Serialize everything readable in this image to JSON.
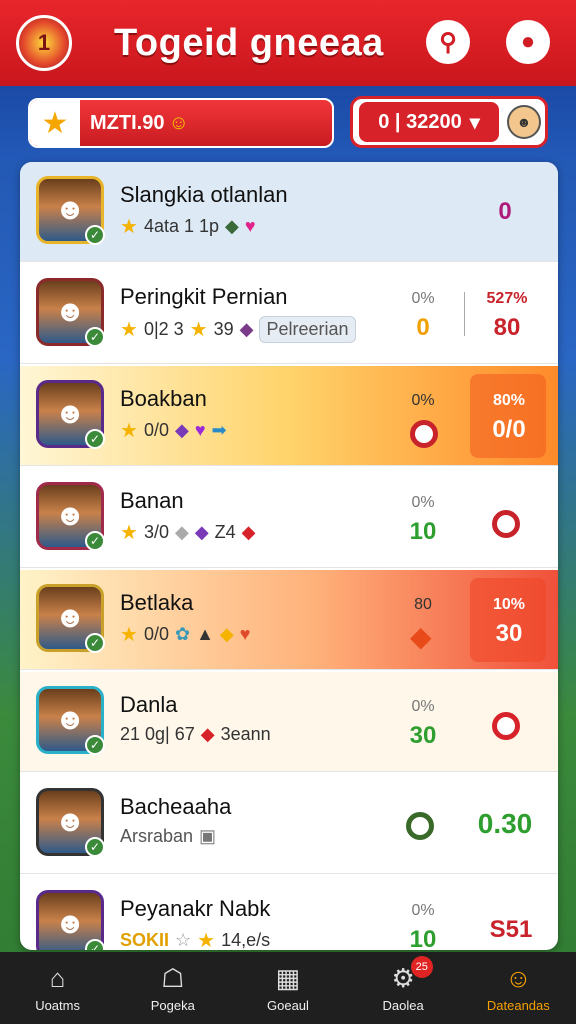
{
  "header": {
    "title": "Togeid gneeaa",
    "logo_glyph": "1",
    "search_icon": "search-icon",
    "profile_icon": "profile-icon"
  },
  "subbar": {
    "coins": "MZTI.90",
    "score": "0 | 32200",
    "chevron": "▾"
  },
  "rows": [
    {
      "name": "Slangkia otlanlan",
      "stats": "4ata 1 1p",
      "right_val": "0"
    },
    {
      "name": "Peringkit Pernian",
      "stats": "0|2  3",
      "stats2": "39",
      "chip": "Pelreerian",
      "pct": "0%",
      "val": "0",
      "right_pct": "527%",
      "right_val": "80"
    },
    {
      "name": "Boakban",
      "stats": "0/0",
      "pct": "0%",
      "right_pct": "80%",
      "right_val": "0/0"
    },
    {
      "name": "Banan",
      "stats": "3/0",
      "stats2": "Z4",
      "pct": "0%",
      "val": "10"
    },
    {
      "name": "Betlaka",
      "stats": "0/0",
      "pct": "80",
      "right_pct": "10%",
      "right_val": "30"
    },
    {
      "name": "Danla",
      "stats": "21 0g| 67",
      "stats2": "3eann",
      "pct": "0%",
      "val": "30"
    },
    {
      "name": "Bacheaaha",
      "stats": "Arsraban",
      "right_val": "0.30"
    },
    {
      "name": "Peyanakr Nabk",
      "stats": "SOKII",
      "stats2": "14,e/s",
      "pct": "0%",
      "val": "10",
      "right_val": "S51"
    }
  ],
  "nav": [
    {
      "label": "Uoatms",
      "icon": "home-icon"
    },
    {
      "label": "Pogeka",
      "icon": "house-icon"
    },
    {
      "label": "Goeaul",
      "icon": "news-icon"
    },
    {
      "label": "Daolea",
      "icon": "chat-icon",
      "badge": "25"
    },
    {
      "label": "Dateandas",
      "icon": "user-icon"
    }
  ],
  "colors": {
    "header_red": "#d01c22",
    "accent_orange": "#f5a000",
    "green": "#2e9e2e",
    "red": "#c8222a"
  }
}
